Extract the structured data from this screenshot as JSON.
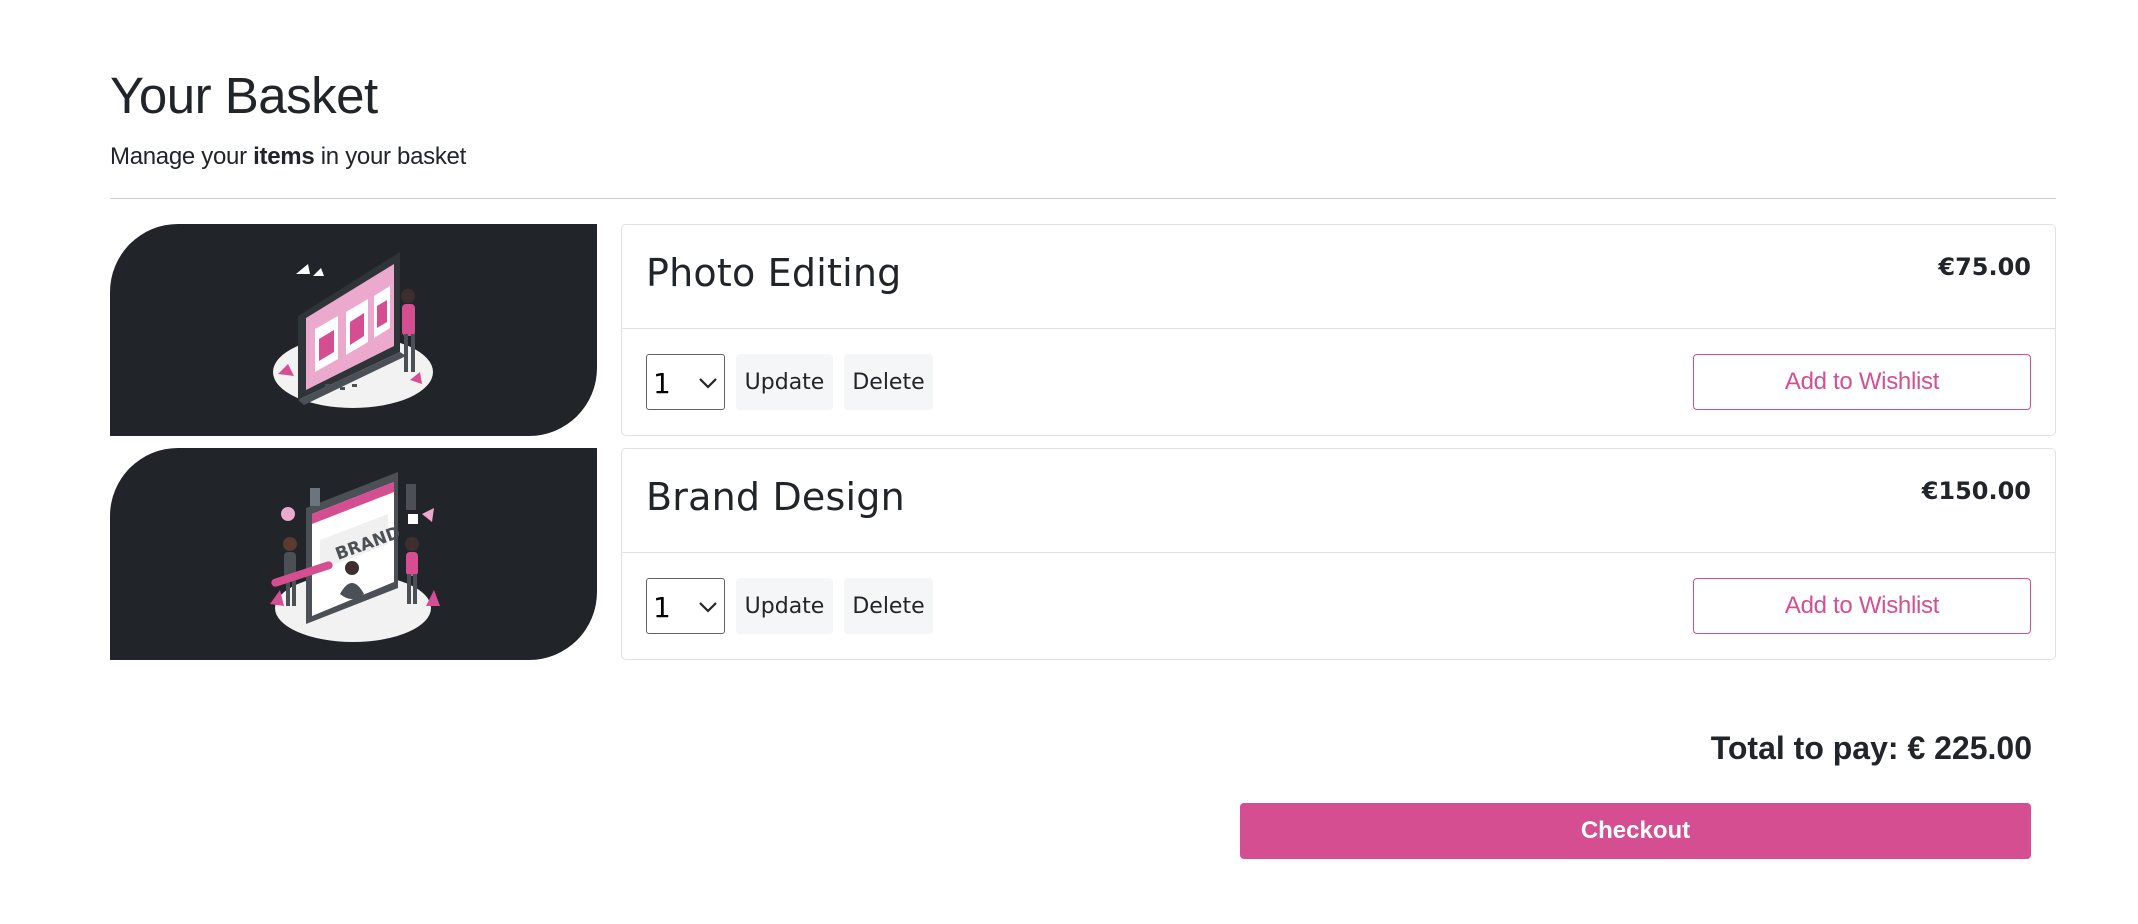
{
  "header": {
    "title": "Your Basket",
    "subtitle_before": "Manage your",
    "subtitle_bold": "items",
    "subtitle_after": "in your basket"
  },
  "items": [
    {
      "name": "Photo Editing",
      "price": "€75.00",
      "quantity": "1",
      "update_label": "Update",
      "delete_label": "Delete",
      "wishlist_label": "Add to Wishlist",
      "image_icon": "photo-editing-illustration"
    },
    {
      "name": "Brand Design",
      "price": "€150.00",
      "quantity": "1",
      "update_label": "Update",
      "delete_label": "Delete",
      "wishlist_label": "Add to Wishlist",
      "image_icon": "brand-design-illustration",
      "image_text": "BRAND"
    }
  ],
  "summary": {
    "total_label": "Total to pay: € 225.00",
    "checkout_label": "Checkout"
  },
  "colors": {
    "accent": "#d64e92",
    "thumb_background": "#212529",
    "text": "#212529"
  }
}
